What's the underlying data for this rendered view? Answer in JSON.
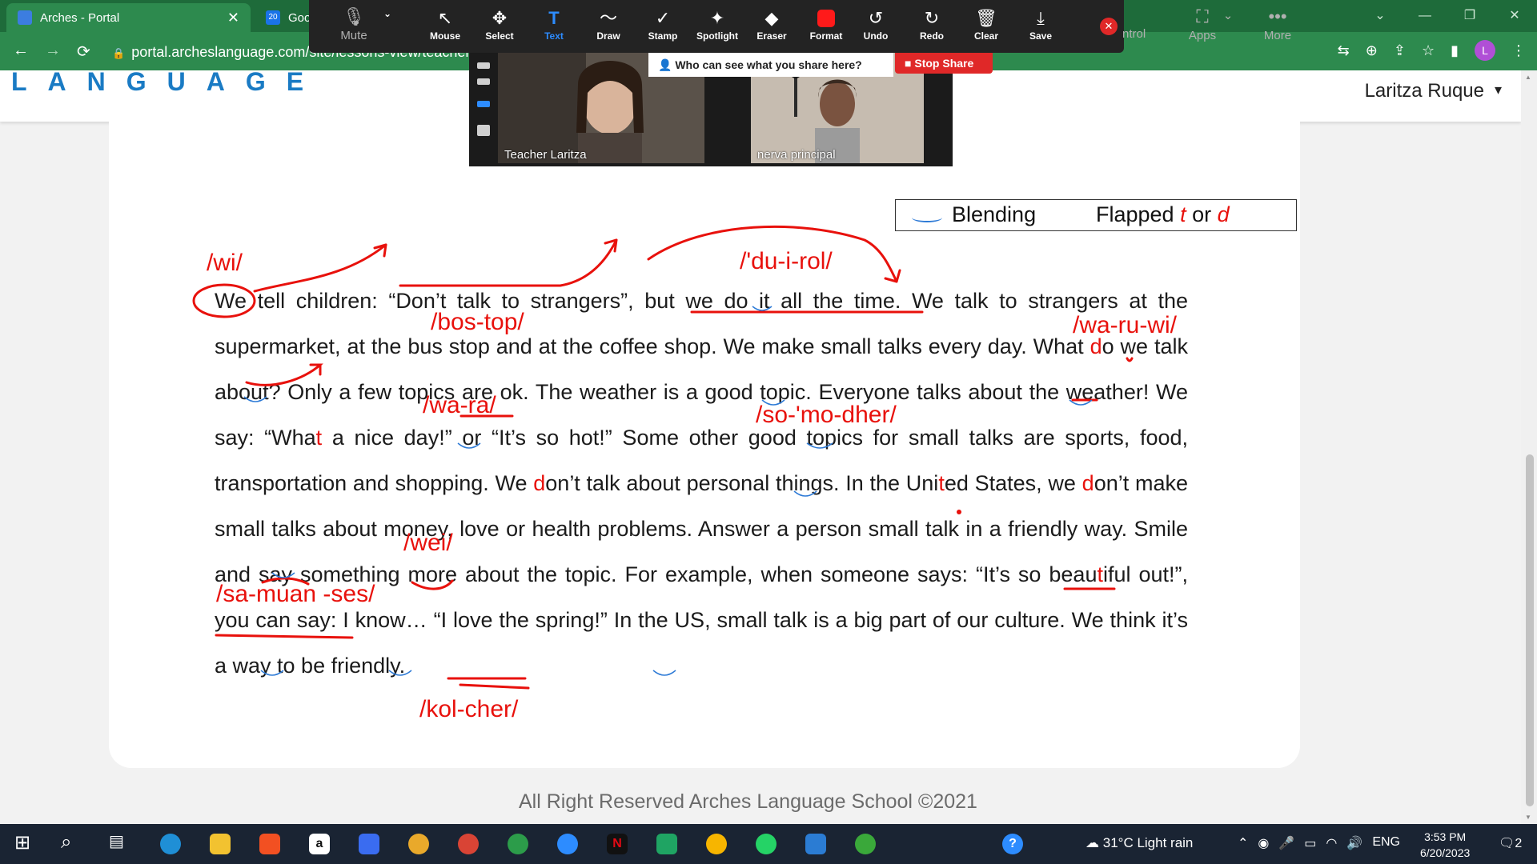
{
  "browser": {
    "tabs": [
      {
        "label": "Arches - Portal",
        "active": true
      },
      {
        "label": "Goog",
        "active": false
      }
    ],
    "url": "portal.archeslanguage.com/site/lessons-view/teacher",
    "profile_initial": "L"
  },
  "site": {
    "logo_text": "LANGUAGE",
    "user_name": "Laritza Ruque",
    "footer": "All Right Reserved Arches Language School ©2021"
  },
  "zoom": {
    "mute_label": "Mute",
    "tools": [
      "Mouse",
      "Select",
      "Text",
      "Draw",
      "Stamp",
      "Spotlight",
      "Eraser",
      "Format",
      "Undo",
      "Redo",
      "Clear",
      "Save"
    ],
    "active_tool": "Text",
    "control_label": "ntrol",
    "apps_label": "Apps",
    "more_label": "More",
    "share_notice": "Who can see what you share here?",
    "stop_share": "Stop Share",
    "participants": [
      "Teacher Laritza",
      "nerva principal"
    ],
    "accent_color": "#2d8cff",
    "stop_color": "#e02828"
  },
  "lesson": {
    "legend": {
      "blending": "Blending",
      "flapped_prefix": "Flapped",
      "t": "t",
      "or": "or",
      "d": "d"
    },
    "p1": "We tell children: “Don’t talk to strangers”, but we do it all the time. We talk to strangers at the supermarket, at the bus stop and at the coffee shop. We make small talks every day. What ",
    "r1": "d",
    "p2": "o we talk about? Only a few topics are ok. The weather is a good topic. Everyone talks about the weather! We say: “Wha",
    "r2": "t",
    "p3": " a nice day!” or “It’s so hot!” Some other good topics for small talks are sports, food, transportation and shopping. We ",
    "r3": "d",
    "p4": "on’t talk about personal things. In the Uni",
    "r4": "t",
    "p5": "ed States, we ",
    "r5": "d",
    "p6": "on’t make small talks about money, love or health problems. Answer a person small talk in a friendly way. Smile and say something more about the topic. For example, when someone says: “It’s so beau",
    "r6": "t",
    "p7": "iful out!”, you can say: I know… “I love the spring!” In the US, small talk is a big part of our culture. We think it’s a way to be friendly.",
    "annotations": [
      "/wi/",
      "/'du-i-rol/",
      "/bos-top/",
      "/wa-ru-wi/",
      "/wa-ra/",
      "/so-'mo-dher/",
      "/wei/",
      "/sa-muan -ses/",
      "/kol-cher/"
    ],
    "ink_color": "#e8110c",
    "blend_color": "#2d7ad6"
  },
  "taskbar": {
    "weather": "31°C  Light rain",
    "language": "ENG",
    "time": "3:53 PM",
    "date": "6/20/2023",
    "notifications": "2"
  }
}
